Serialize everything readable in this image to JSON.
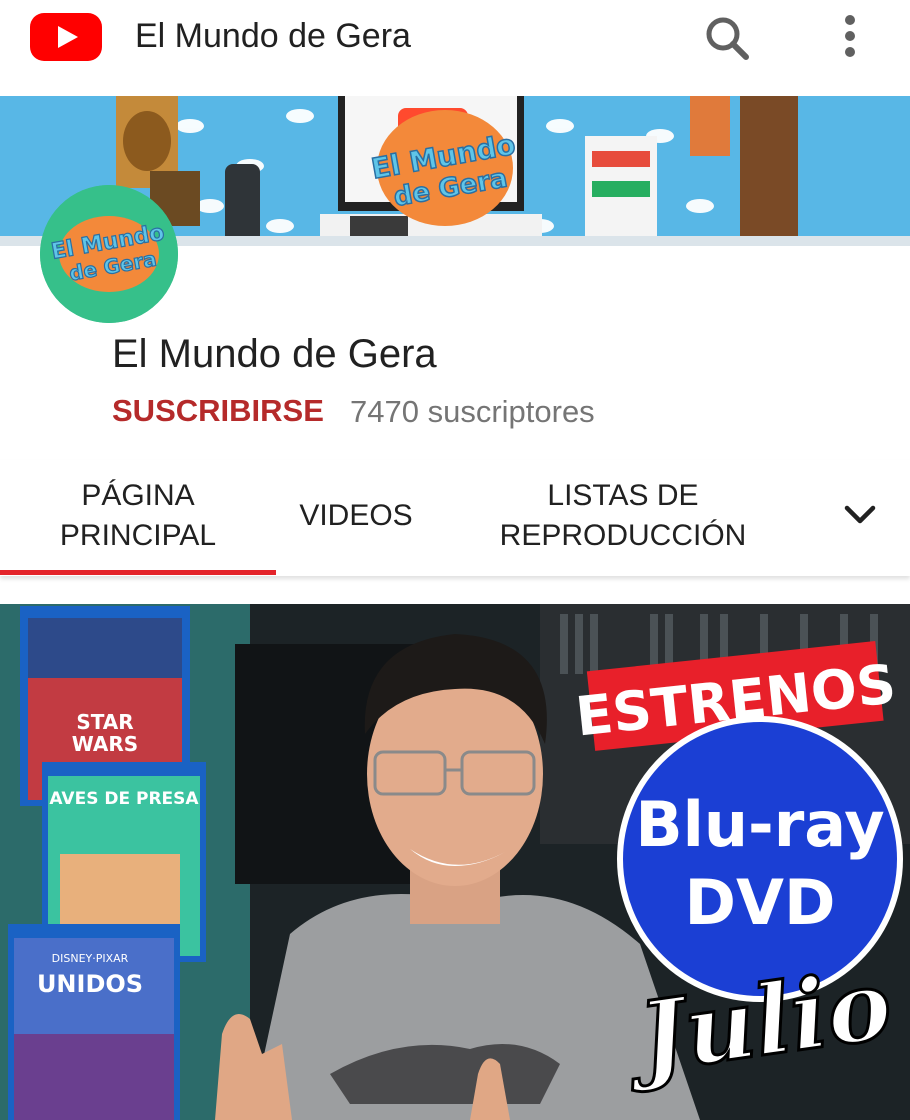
{
  "appbar": {
    "title": "El Mundo de Gera",
    "logo_icon": "youtube-logo-icon",
    "search_icon": "search-icon",
    "more_icon": "more-vertical-icon"
  },
  "banner": {
    "logo_text_line1": "El Mundo",
    "logo_text_line2": "de Gera"
  },
  "avatar": {
    "text_line1": "El Mundo",
    "text_line2": "de Gera"
  },
  "channel": {
    "name": "El Mundo de Gera",
    "subscribe_label": "SUSCRIBIRSE",
    "subscribers": "7470 suscriptores"
  },
  "tabs": [
    {
      "line1": "PÁGINA",
      "line2": "PRINCIPAL",
      "selected": true
    },
    {
      "line1": "VIDEOS",
      "line2": "",
      "selected": false
    },
    {
      "line1": "LISTAS DE",
      "line2": "REPRODUCCIÓN",
      "selected": false
    }
  ],
  "tabs_more_icon": "chevron-down-icon",
  "featured": {
    "estrenos": "ESTRENOS",
    "bluray": "Blu-ray",
    "dvd": "DVD",
    "julio": "Julio",
    "covers": [
      {
        "title": "STAR",
        "subtitle": "WARS"
      },
      {
        "title": "AVES DE PRESA",
        "subtitle": ""
      },
      {
        "title": "UNIDOS",
        "subtitle": "DISNEY·PIXAR"
      }
    ]
  },
  "colors": {
    "brand_red": "#ff0000",
    "subscribe_red": "#b52a2a",
    "tab_indicator": "#e4242b",
    "banner_blue": "#4fb0df",
    "avatar_green": "#36c08a",
    "estrenos_red": "#e8202a",
    "circle_blue": "#1b3fd4"
  }
}
